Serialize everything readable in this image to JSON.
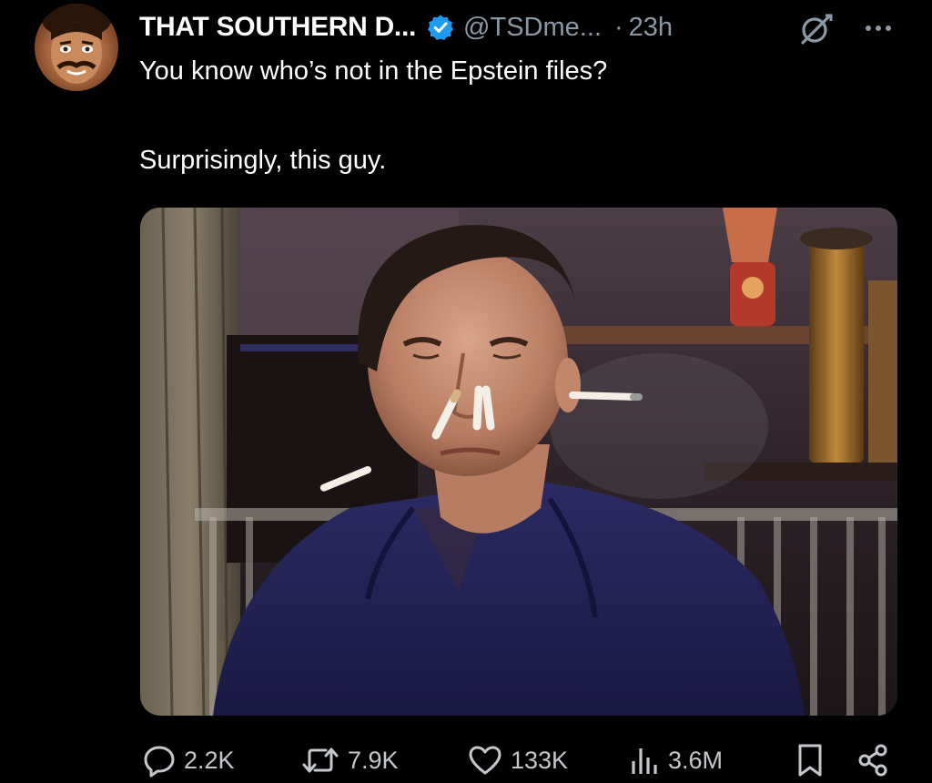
{
  "post": {
    "author": {
      "display_name": "THAT SOUTHERN D...",
      "handle": "@TSDme...",
      "verified": true,
      "avatar": "avatar-photo"
    },
    "separator": "·",
    "time": "23h",
    "text_lines": [
      "You know who’s not in the Epstein files?",
      "Surprisingly, this guy."
    ],
    "media": {
      "type": "photo",
      "icon": "photo-man-smoking-cigarettes"
    }
  },
  "actions": {
    "reply": {
      "icon": "reply-icon",
      "count": "2.2K"
    },
    "repost": {
      "icon": "repost-icon",
      "count": "7.9K"
    },
    "like": {
      "icon": "heart-icon",
      "count": "133K"
    },
    "views": {
      "icon": "views-icon",
      "count": "3.6M"
    },
    "bookmark": {
      "icon": "bookmark-icon"
    },
    "share": {
      "icon": "share-icon"
    }
  },
  "icons": {
    "grok": "grok-icon",
    "more": "more-icon"
  },
  "colors": {
    "background": "#000000",
    "text": "#ffffff",
    "secondary_text": "#8b98a5",
    "verified_blue": "#1d9bf0",
    "shirt_navy": "#23214f"
  }
}
